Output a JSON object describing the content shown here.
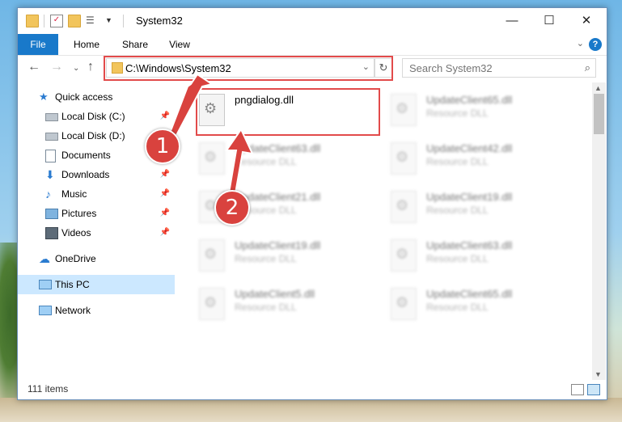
{
  "window": {
    "title": "System32",
    "controls": {
      "minimize": "—",
      "maximize": "☐",
      "close": "✕"
    }
  },
  "ribbon": {
    "tabs": [
      {
        "label": "File"
      },
      {
        "label": "Home"
      },
      {
        "label": "Share"
      },
      {
        "label": "View"
      }
    ],
    "help": "?"
  },
  "navbar": {
    "address": "C:\\Windows\\System32",
    "search_placeholder": "Search System32"
  },
  "sidebar": {
    "items": [
      {
        "label": "Quick access",
        "icon": "star-icon"
      },
      {
        "label": "Local Disk (C:)",
        "icon": "drive-icon",
        "pinned": true
      },
      {
        "label": "Local Disk (D:)",
        "icon": "drive-icon",
        "pinned": false
      },
      {
        "label": "Documents",
        "icon": "documents-icon",
        "pinned": true
      },
      {
        "label": "Downloads",
        "icon": "downloads-icon",
        "pinned": true
      },
      {
        "label": "Music",
        "icon": "music-icon",
        "pinned": true
      },
      {
        "label": "Pictures",
        "icon": "pictures-icon",
        "pinned": true
      },
      {
        "label": "Videos",
        "icon": "videos-icon",
        "pinned": true
      },
      {
        "label": "OneDrive",
        "icon": "cloud-icon"
      },
      {
        "label": "This PC",
        "icon": "computer-icon",
        "selected": true
      },
      {
        "label": "Network",
        "icon": "network-icon"
      }
    ]
  },
  "files": {
    "column1": [
      {
        "name": "pngdialog.dll",
        "type": ""
      },
      {
        "name": "UpdateClient63.dll",
        "type": "Resource DLL"
      },
      {
        "name": "UpdateClient21.dll",
        "type": "Resource DLL"
      },
      {
        "name": "UpdateClient19.dll",
        "type": "Resource DLL"
      },
      {
        "name": "UpdateClient5.dll",
        "type": "Resource DLL"
      }
    ],
    "column2": [
      {
        "name": "UpdateClient65.dll",
        "type": "Resource DLL"
      },
      {
        "name": "UpdateClient42.dll",
        "type": "Resource DLL"
      },
      {
        "name": "UpdateClient19.dll",
        "type": "Resource DLL"
      },
      {
        "name": "UpdateClient63.dll",
        "type": "Resource DLL"
      },
      {
        "name": "UpdateClient65.dll",
        "type": "Resource DLL"
      }
    ]
  },
  "status": {
    "items": "111 items"
  },
  "annotations": {
    "step1": "1",
    "step2": "2",
    "color": "#d9423e"
  }
}
